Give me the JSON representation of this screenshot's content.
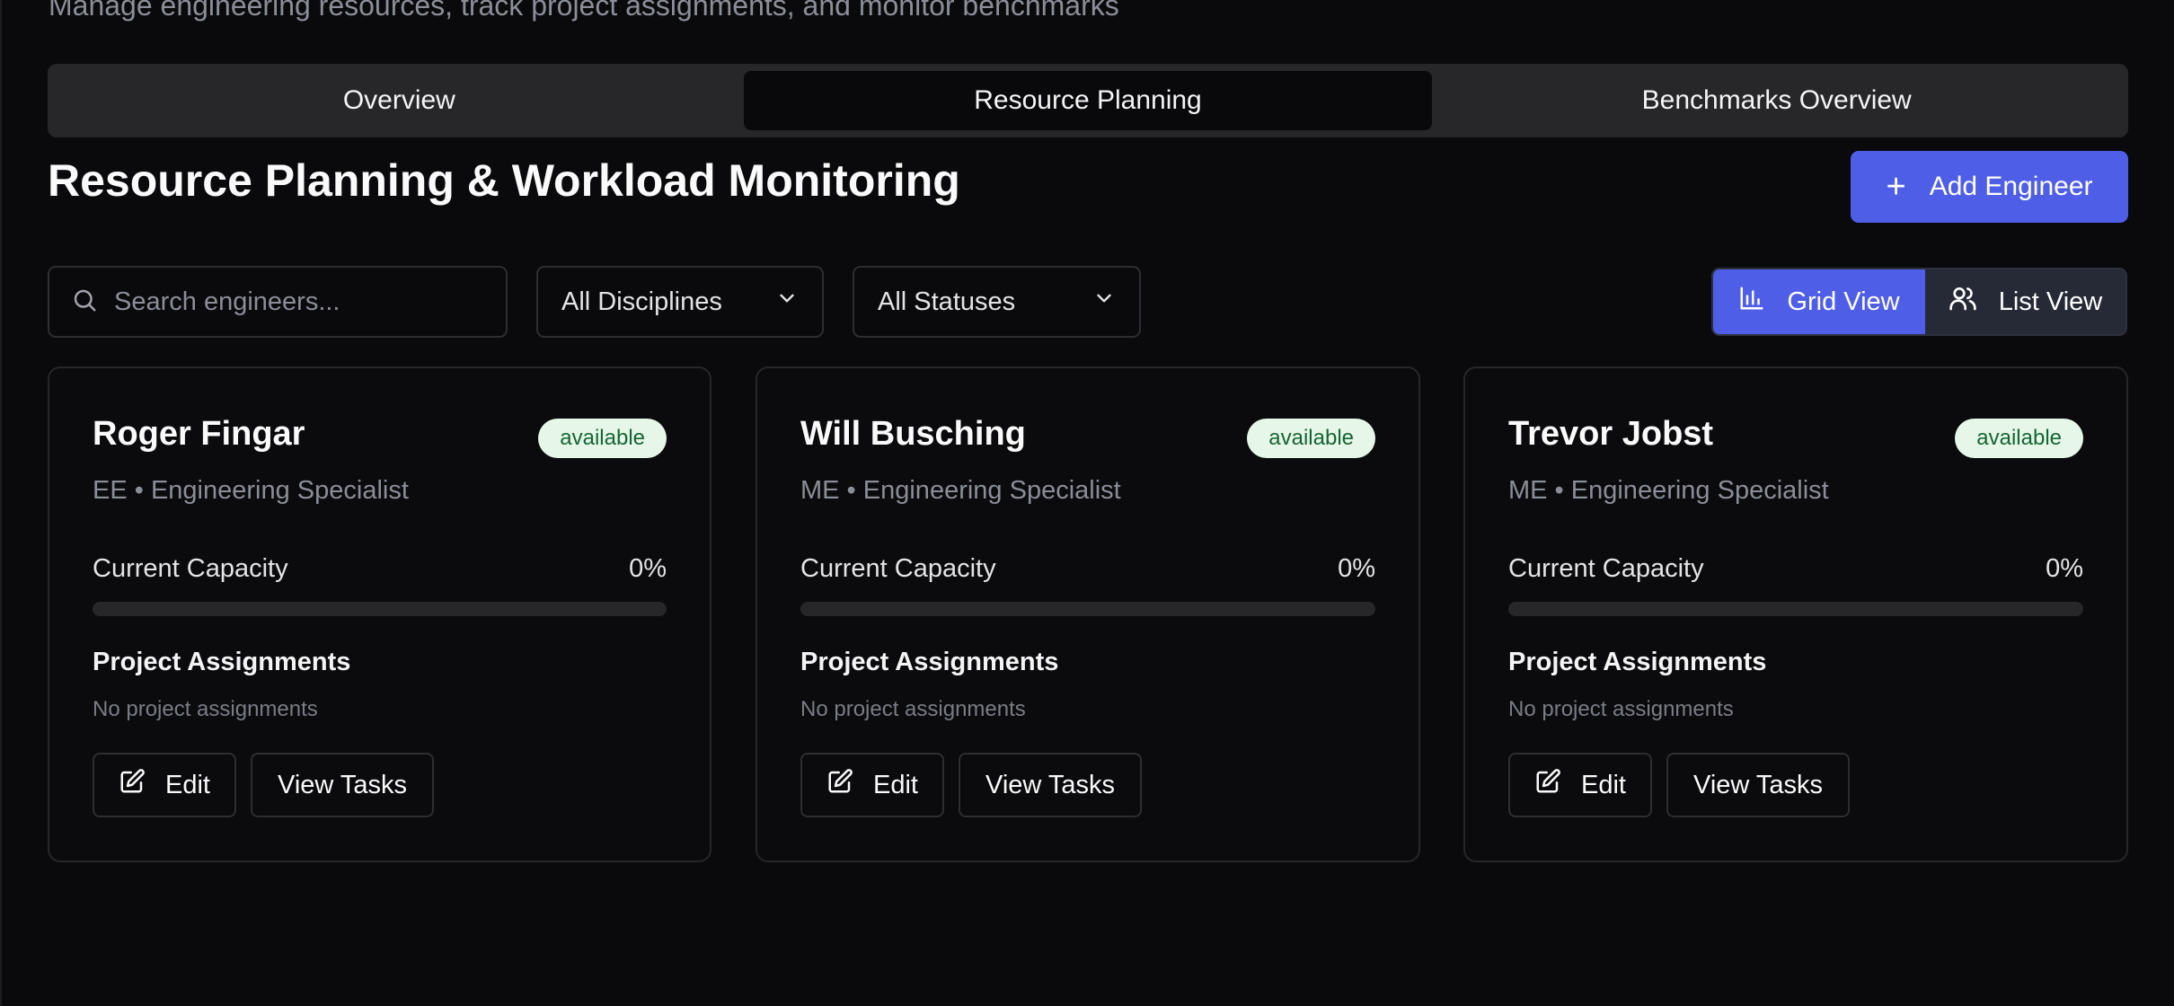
{
  "header": {
    "subtitle": "Manage engineering resources, track project assignments, and monitor benchmarks"
  },
  "tabs": [
    {
      "label": "Overview",
      "active": false
    },
    {
      "label": "Resource Planning",
      "active": true
    },
    {
      "label": "Benchmarks Overview",
      "active": false
    }
  ],
  "main": {
    "title": "Resource Planning & Workload Monitoring",
    "add_button_label": "Add Engineer"
  },
  "filters": {
    "search_placeholder": "Search engineers...",
    "discipline_selected": "All Disciplines",
    "status_selected": "All Statuses",
    "grid_view_label": "Grid View",
    "list_view_label": "List View",
    "active_view": "grid"
  },
  "engineers": [
    {
      "name": "Roger Fingar",
      "status": "available",
      "role": "EE • Engineering Specialist",
      "capacity_label": "Current Capacity",
      "capacity_value": "0%",
      "capacity_fraction": 0,
      "assignments_title": "Project Assignments",
      "assignments_empty": "No project assignments",
      "edit_label": "Edit",
      "view_tasks_label": "View Tasks"
    },
    {
      "name": "Will Busching",
      "status": "available",
      "role": "ME • Engineering Specialist",
      "capacity_label": "Current Capacity",
      "capacity_value": "0%",
      "capacity_fraction": 0,
      "assignments_title": "Project Assignments",
      "assignments_empty": "No project assignments",
      "edit_label": "Edit",
      "view_tasks_label": "View Tasks"
    },
    {
      "name": "Trevor Jobst",
      "status": "available",
      "role": "ME • Engineering Specialist",
      "capacity_label": "Current Capacity",
      "capacity_value": "0%",
      "capacity_fraction": 0,
      "assignments_title": "Project Assignments",
      "assignments_empty": "No project assignments",
      "edit_label": "Edit",
      "view_tasks_label": "View Tasks"
    }
  ],
  "colors": {
    "accent": "#4f5ee6",
    "background": "#0a0a0c",
    "badge_bg": "#e6f7e9",
    "badge_text": "#166534"
  },
  "icons": {
    "add": "plus-icon",
    "search": "search-icon",
    "dropdown": "chevron-down-icon",
    "grid_view": "bar-chart-icon",
    "list_view": "users-icon",
    "edit": "edit-icon"
  }
}
